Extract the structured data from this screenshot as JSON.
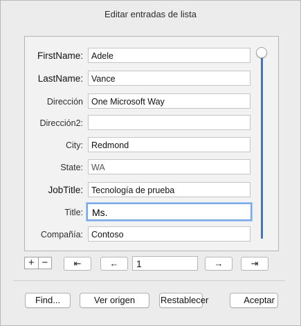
{
  "dialog": {
    "title": "Editar entradas de lista"
  },
  "fields": [
    {
      "label": "FirstName:",
      "value": "Adele"
    },
    {
      "label": "LastName:",
      "value": "Vance"
    },
    {
      "label": "Dirección",
      "value": "One Microsoft Way"
    },
    {
      "label": "Dirección2:",
      "value": ""
    },
    {
      "label": "City:",
      "value": "Redmond"
    },
    {
      "label": "State:",
      "value": "WA"
    },
    {
      "label": "JobTitle:",
      "value": "Tecnología de prueba"
    },
    {
      "label": "Title:",
      "value": "Ms."
    },
    {
      "label": "Compañía:",
      "value": "Contoso"
    }
  ],
  "nav": {
    "add": "+",
    "remove": "−",
    "first": "⇤",
    "prev": "←",
    "record": "1",
    "next": "→",
    "last": "⇥"
  },
  "buttons": {
    "find": "Find...",
    "source": "Ver origen",
    "reset": "Restablecer",
    "accept": "Aceptar"
  },
  "colors": {
    "accent": "#2f78d8",
    "focus_ring": "#7aa7e6"
  }
}
